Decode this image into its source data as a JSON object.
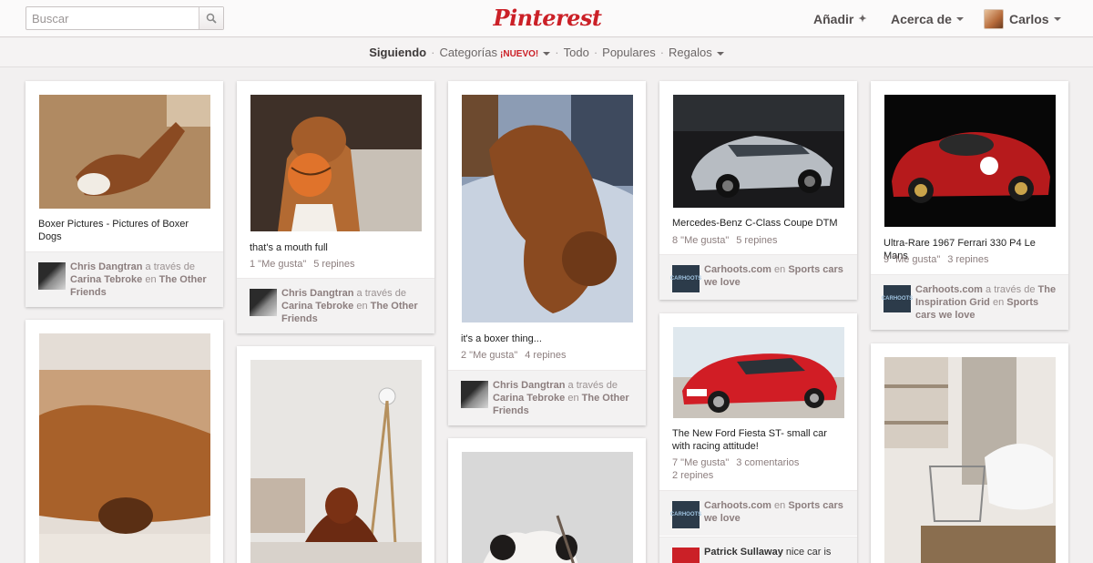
{
  "header": {
    "search_placeholder": "Buscar",
    "logo": "Pinterest",
    "add": "Añadir",
    "about": "Acerca de",
    "user": "Carlos"
  },
  "subnav": {
    "following": "Siguiendo",
    "categories": "Categorías",
    "new_badge": "¡NUEVO!",
    "all": "Todo",
    "popular": "Populares",
    "gifts": "Regalos"
  },
  "pins": [
    {
      "desc": "Boxer Pictures - Pictures of Boxer Dogs",
      "likes": "",
      "repins": "",
      "attr_name": "Chris Dangtran",
      "attr_via": "a través de",
      "attr_source": "Carina Tebroke",
      "attr_en": "en",
      "attr_board": "The Other Friends"
    },
    {
      "desc": "that's a mouth full",
      "likes": "1 \"Me gusta\"",
      "repins": "5 repines",
      "attr_name": "Chris Dangtran",
      "attr_via": "a través de",
      "attr_source": "Carina Tebroke",
      "attr_en": "en",
      "attr_board": "The Other Friends"
    },
    {
      "desc": "it's a boxer thing...",
      "likes": "2 \"Me gusta\"",
      "repins": "4 repines",
      "attr_name": "Chris Dangtran",
      "attr_via": "a través de",
      "attr_source": "Carina Tebroke",
      "attr_en": "en",
      "attr_board": "The Other Friends"
    },
    {
      "desc": "Mercedes-Benz C-Class Coupe DTM",
      "likes": "8 \"Me gusta\"",
      "repins": "5 repines",
      "attr_name": "Carhoots.com",
      "attr_en": "en",
      "attr_board": "Sports cars we love"
    },
    {
      "desc": "Ultra-Rare 1967 Ferrari 330 P4 Le Mans",
      "likes": "9 \"Me gusta\"",
      "repins": "3 repines",
      "attr_name": "Carhoots.com",
      "attr_via": "a través de",
      "attr_source": "The Inspiration Grid",
      "attr_en": "en",
      "attr_board": "Sports cars we love"
    },
    {
      "desc": "The New Ford Fiesta ST- small car with racing attitude!",
      "likes": "7 \"Me gusta\"",
      "comments": "3 comentarios",
      "repins": "2 repines",
      "attr_name": "Carhoots.com",
      "attr_en": "en",
      "attr_board": "Sports cars we love",
      "comment_name": "Patrick Sullaway",
      "comment_text": "nice car is"
    }
  ],
  "colors": {
    "brand": "#cb2027",
    "background": "#f2f0f0",
    "card": "#ffffff"
  }
}
